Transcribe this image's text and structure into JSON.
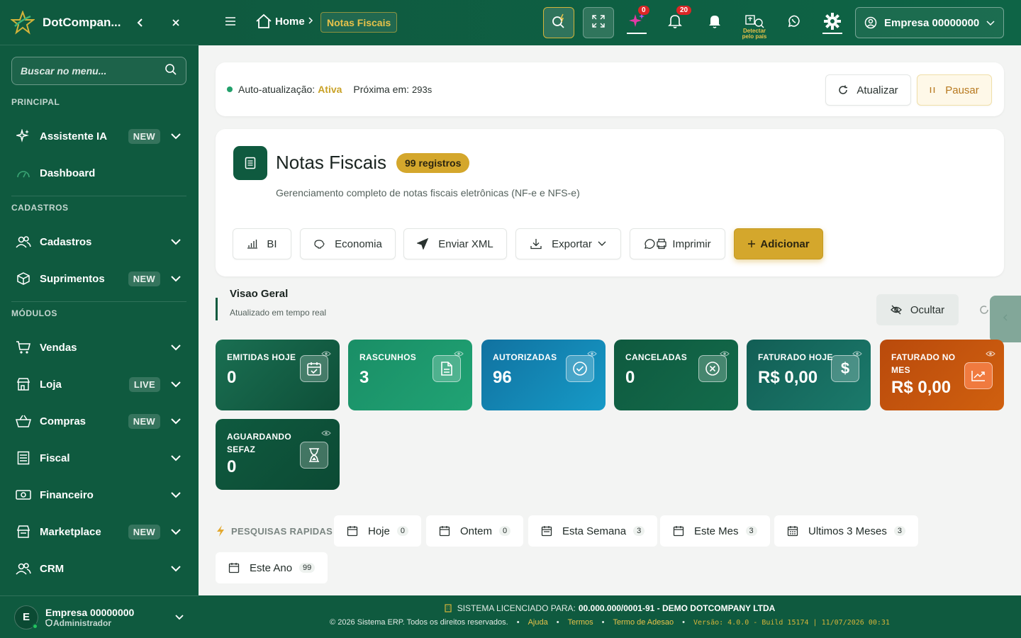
{
  "sidebar": {
    "brand": "DotCompan...",
    "search_placeholder": "Buscar no menu...",
    "sections": {
      "principal": "PRINCIPAL",
      "cadastros": "CADASTROS",
      "modulos": "MÓDULOS"
    },
    "items": [
      {
        "label": "Assistente IA",
        "badge": "NEW",
        "icon": "sparkles-icon"
      },
      {
        "label": "Dashboard",
        "badge": "",
        "icon": "gauge-icon"
      },
      {
        "label": "Cadastros",
        "badge": "",
        "icon": "users-icon"
      },
      {
        "label": "Suprimentos",
        "badge": "NEW",
        "icon": "box-icon"
      },
      {
        "label": "Vendas",
        "badge": "",
        "icon": "cart-icon"
      },
      {
        "label": "Loja",
        "badge": "LIVE",
        "icon": "store-icon"
      },
      {
        "label": "Compras",
        "badge": "NEW",
        "icon": "basket-icon"
      },
      {
        "label": "Fiscal",
        "badge": "",
        "icon": "receipt-icon"
      },
      {
        "label": "Financeiro",
        "badge": "",
        "icon": "money-icon"
      },
      {
        "label": "Marketplace",
        "badge": "NEW",
        "icon": "shop-icon"
      },
      {
        "label": "CRM",
        "badge": "",
        "icon": "people-icon"
      }
    ],
    "user": {
      "initial": "E",
      "name": "Empresa 00000000",
      "role": "Administrador"
    }
  },
  "topbar": {
    "home": "Home",
    "crumb": "Notas Fiscais",
    "ai_count": "0",
    "notif_count": "20",
    "detect_label": "Detectar pelo país",
    "company": "Empresa 00000000"
  },
  "autorefresh": {
    "label": "Auto-atualização:",
    "status": "Ativa",
    "next_label": "Próxima em:",
    "next_value": "293s",
    "refresh_btn": "Atualizar",
    "pause_btn": "Pausar"
  },
  "header": {
    "title": "Notas Fiscais",
    "count_badge": "99 registros",
    "subtitle": "Gerenciamento completo de notas fiscais eletrônicas (NF-e e NFS-e)",
    "actions": {
      "bi": "BI",
      "economia": "Economia",
      "enviar_xml": "Enviar XML",
      "exportar": "Exportar",
      "imprimir": "Imprimir",
      "adicionar": "Adicionar"
    }
  },
  "overview": {
    "title": "Visao Geral",
    "subtitle": "Atualizado em tempo real",
    "hide_btn": "Ocultar"
  },
  "stats": [
    {
      "label": "EMITIDAS HOJE",
      "value": "0",
      "icon": "calendar-check-icon",
      "color": "#17694c"
    },
    {
      "label": "RASCUNHOS",
      "value": "3",
      "icon": "document-icon",
      "color": "#1b9a6e"
    },
    {
      "label": "AUTORIZADAS",
      "value": "96",
      "icon": "check-circle-icon",
      "color": "#1282b0"
    },
    {
      "label": "CANCELADAS",
      "value": "0",
      "icon": "x-circle-icon",
      "color": "#0f5a3f"
    },
    {
      "label": "FATURADO HOJE",
      "value": "R$ 0,00",
      "icon": "dollar-icon",
      "color": "#156a63"
    },
    {
      "label": "FATURADO NO MES",
      "value": "R$ 0,00",
      "icon": "trend-up-icon",
      "color": "#c4520f"
    },
    {
      "label": "AGUARDANDO SEFAZ",
      "value": "0",
      "icon": "hourglass-icon",
      "color": "#0f5a3f"
    }
  ],
  "quick": {
    "title": "PESQUISAS RAPIDAS",
    "items": [
      {
        "label": "Hoje",
        "count": "0"
      },
      {
        "label": "Ontem",
        "count": "0"
      },
      {
        "label": "Esta Semana",
        "count": "3"
      },
      {
        "label": "Este Mes",
        "count": "3"
      },
      {
        "label": "Ultimos 3 Meses",
        "count": "3"
      },
      {
        "label": "Este Ano",
        "count": "99"
      }
    ]
  },
  "footer": {
    "license_label": "SISTEMA LICENCIADO PARA:",
    "license_value": "00.000.000/0001-91 - DEMO DOTCOMPANY LTDA",
    "copyright": "© 2026 Sistema ERP. Todos os direitos reservados.",
    "links": [
      "Ajuda",
      "Termos",
      "Termo de Adesao"
    ],
    "version": "Versão: 4.0.0 - Build 15174 | 11/07/2026 00:31"
  },
  "colors": {
    "brand": "#0f5a3f",
    "accent": "#d4a72c",
    "status_active": "#c9a227"
  }
}
